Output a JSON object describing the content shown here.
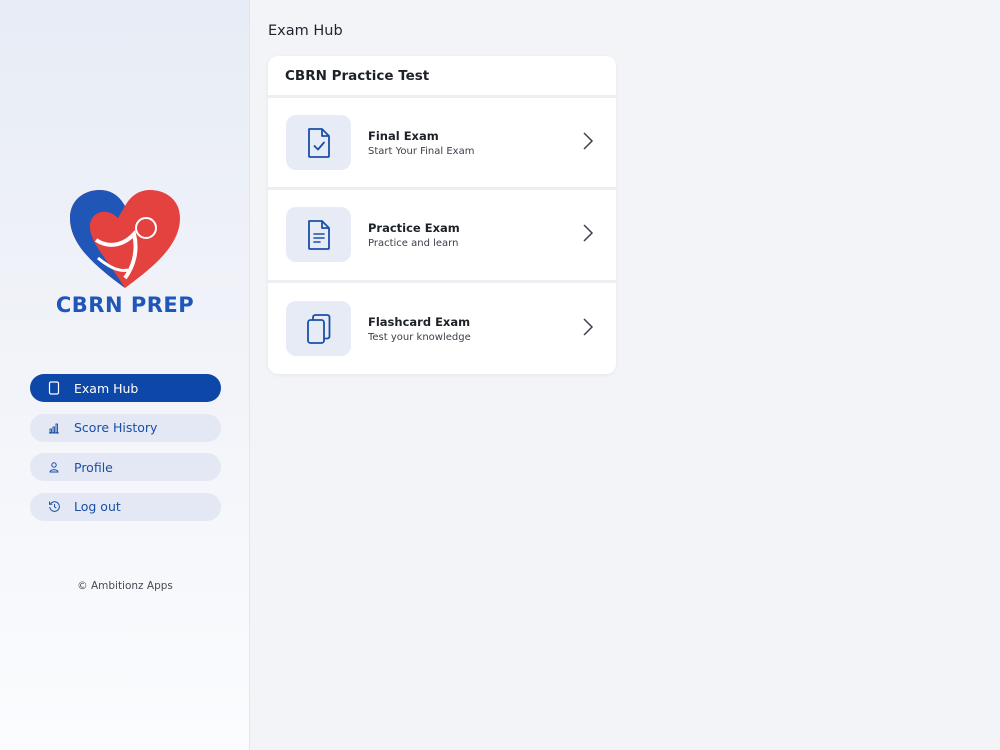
{
  "sidebar": {
    "logo_text": "CBRN PREP",
    "nav": [
      {
        "label": "Exam Hub",
        "icon": "tablet-icon",
        "active": true
      },
      {
        "label": "Score History",
        "icon": "bar-chart-icon",
        "active": false
      },
      {
        "label": "Profile",
        "icon": "person-icon",
        "active": false
      },
      {
        "label": "Log out",
        "icon": "history-icon",
        "active": false
      }
    ],
    "footer": "© Ambitionz Apps"
  },
  "main": {
    "title": "Exam Hub",
    "card": {
      "header": "CBRN Practice Test",
      "items": [
        {
          "title": "Final Exam",
          "subtitle": "Start Your Final Exam",
          "icon": "document-check-icon"
        },
        {
          "title": "Practice Exam",
          "subtitle": "Practice and learn",
          "icon": "document-lines-icon"
        },
        {
          "title": "Flashcard Exam",
          "subtitle": "Test your knowledge",
          "icon": "cards-icon"
        }
      ]
    }
  },
  "colors": {
    "primary": "#0d47a8",
    "nav_bg": "#e3e8f4",
    "icon_bg": "#e6ebf6",
    "logo_red": "#e4423f",
    "logo_blue": "#1f56b8"
  }
}
